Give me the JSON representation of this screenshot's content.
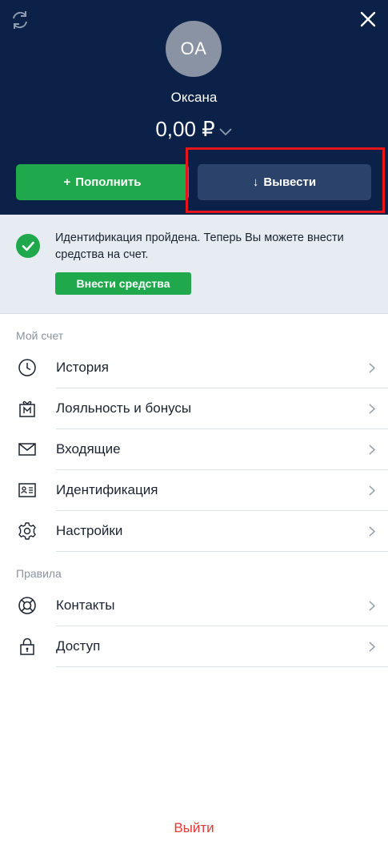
{
  "colors": {
    "header_bg": "#0b2147",
    "deposit_green": "#1fa84c",
    "withdraw_blue": "#2b426a",
    "notice_bg": "#e6ecf1",
    "logout_red": "#e53935",
    "highlight_red": "#e8141c"
  },
  "header": {
    "refresh_icon": "refresh-icon",
    "close_icon": "close-icon",
    "avatar_initials": "OA",
    "username": "Оксана",
    "balance": "0,00 ₽",
    "balance_dropdown_icon": "chevron-down-icon"
  },
  "actions": {
    "deposit_label": "Пополнить",
    "deposit_glyph": "+",
    "withdraw_label": "Вывести",
    "withdraw_glyph": "↓"
  },
  "notice": {
    "text": "Идентификация пройдена. Теперь Вы можете внести средства на счет.",
    "button_label": "Внести средства"
  },
  "sections": {
    "account": {
      "title": "Мой счет",
      "items": [
        {
          "label": "История",
          "icon": "clock-icon"
        },
        {
          "label": "Лояльность и бонусы",
          "icon": "gift-icon"
        },
        {
          "label": "Входящие",
          "icon": "envelope-icon"
        },
        {
          "label": "Идентификация",
          "icon": "id-card-icon"
        },
        {
          "label": "Настройки",
          "icon": "gear-icon"
        }
      ]
    },
    "rules": {
      "title": "Правила",
      "items": [
        {
          "label": "Контакты",
          "icon": "lifebuoy-icon"
        },
        {
          "label": "Доступ",
          "icon": "lock-icon"
        }
      ]
    }
  },
  "logout_label": "Выйти"
}
